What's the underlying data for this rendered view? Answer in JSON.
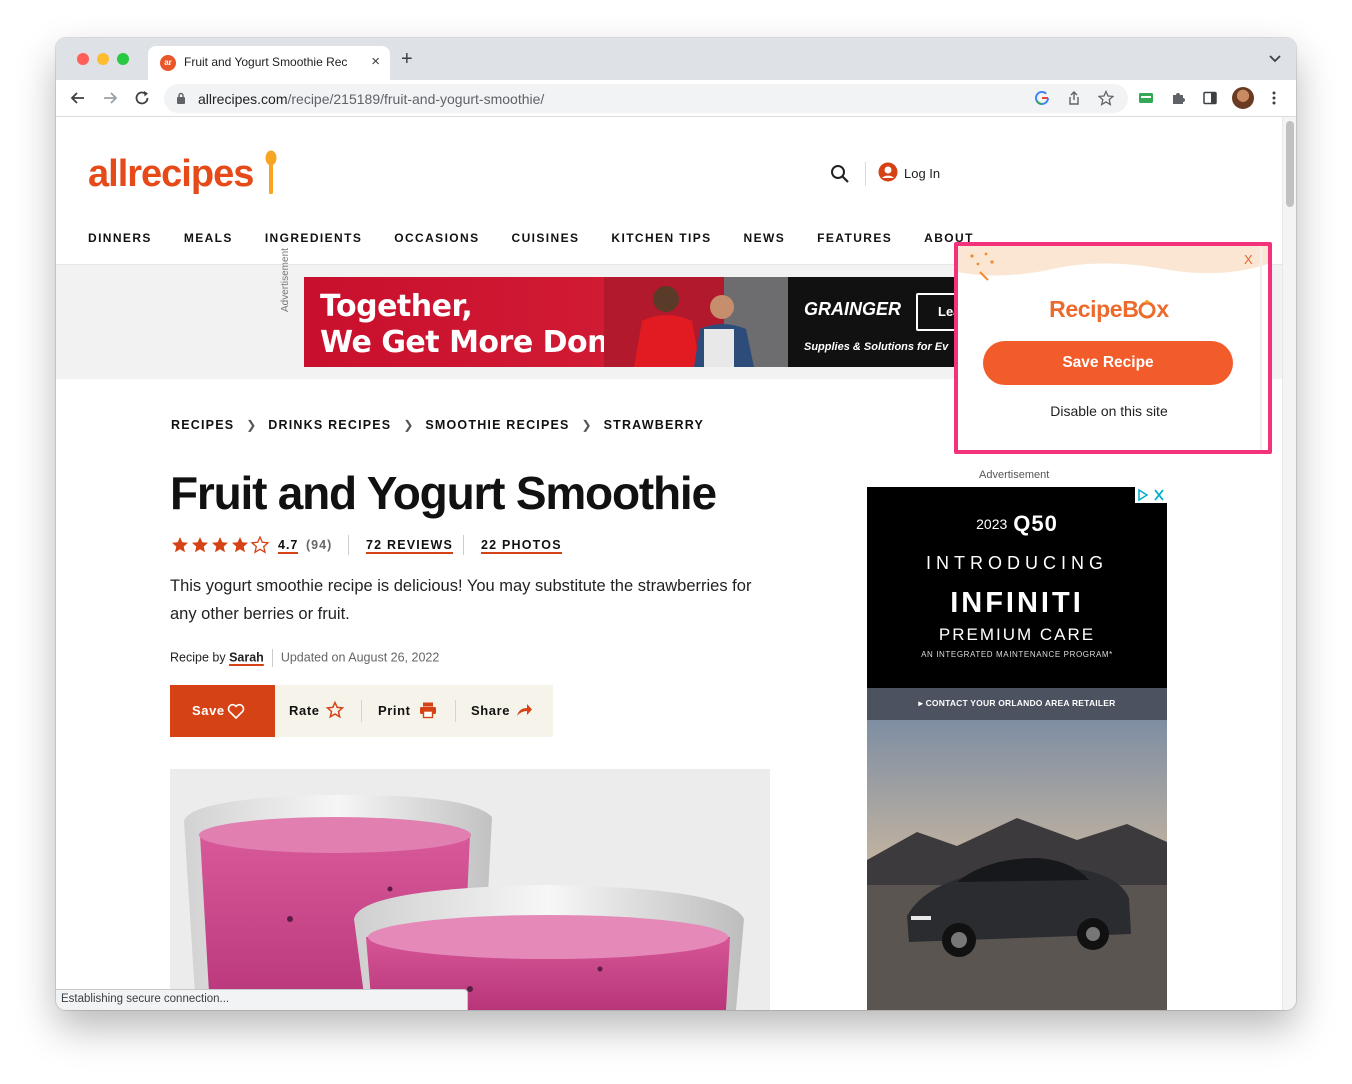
{
  "browser": {
    "tab_title": "Fruit and Yogurt Smoothie Rec",
    "tab_favicon": "ar",
    "url_host": "allrecipes.com",
    "url_path": "/recipe/215189/fruit-and-yogurt-smoothie/",
    "new_tab_label": "+",
    "close_tab_label": "×",
    "status_text": "Establishing secure connection..."
  },
  "site": {
    "logo_text": "allrecipes",
    "login_label": "Log In",
    "nav": [
      "DINNERS",
      "MEALS",
      "INGREDIENTS",
      "OCCASIONS",
      "CUISINES",
      "KITCHEN TIPS",
      "NEWS",
      "FEATURES",
      "ABOUT"
    ]
  },
  "top_ad": {
    "label": "Advertisement",
    "line1": "Together,",
    "line2": "We Get More Done",
    "brand": "GRAINGER",
    "cta": "Lea",
    "tagline": "Supplies & Solutions for Ev"
  },
  "breadcrumbs": [
    "RECIPES",
    "DRINKS RECIPES",
    "SMOOTHIE RECIPES",
    "STRAWBERRY"
  ],
  "recipe": {
    "title": "Fruit and Yogurt Smoothie",
    "rating": "4.7",
    "rating_fraction": 0.94,
    "rating_count": "(94)",
    "reviews": "72 REVIEWS",
    "photos": "22 PHOTOS",
    "description": "This yogurt smoothie recipe is delicious! You may substitute the strawberries for any other berries or fruit.",
    "byline_prefix": "Recipe by",
    "author": "Sarah",
    "updated": "Updated on August 26, 2022"
  },
  "actions": {
    "save": "Save",
    "rate": "Rate",
    "print": "Print",
    "share": "Share"
  },
  "side_ad": {
    "label": "Advertisement",
    "year": "2023",
    "model": "Q50",
    "introducing": "INTRODUCING",
    "brand": "INFINITI",
    "premium": "PREMIUM CARE",
    "program": "AN INTEGRATED MAINTENANCE PROGRAM*",
    "contact": "CONTACT YOUR ORLANDO AREA RETAILER"
  },
  "recipebox": {
    "close_label": "X",
    "brand_prefix": "RecipeB",
    "brand_suffix": "x",
    "save_label": "Save Recipe",
    "disable_label": "Disable on this site"
  },
  "colors": {
    "accent": "#d54215",
    "popup_border": "#f2327b",
    "popup_button": "#f15c2a",
    "logo": "#e64a19"
  }
}
